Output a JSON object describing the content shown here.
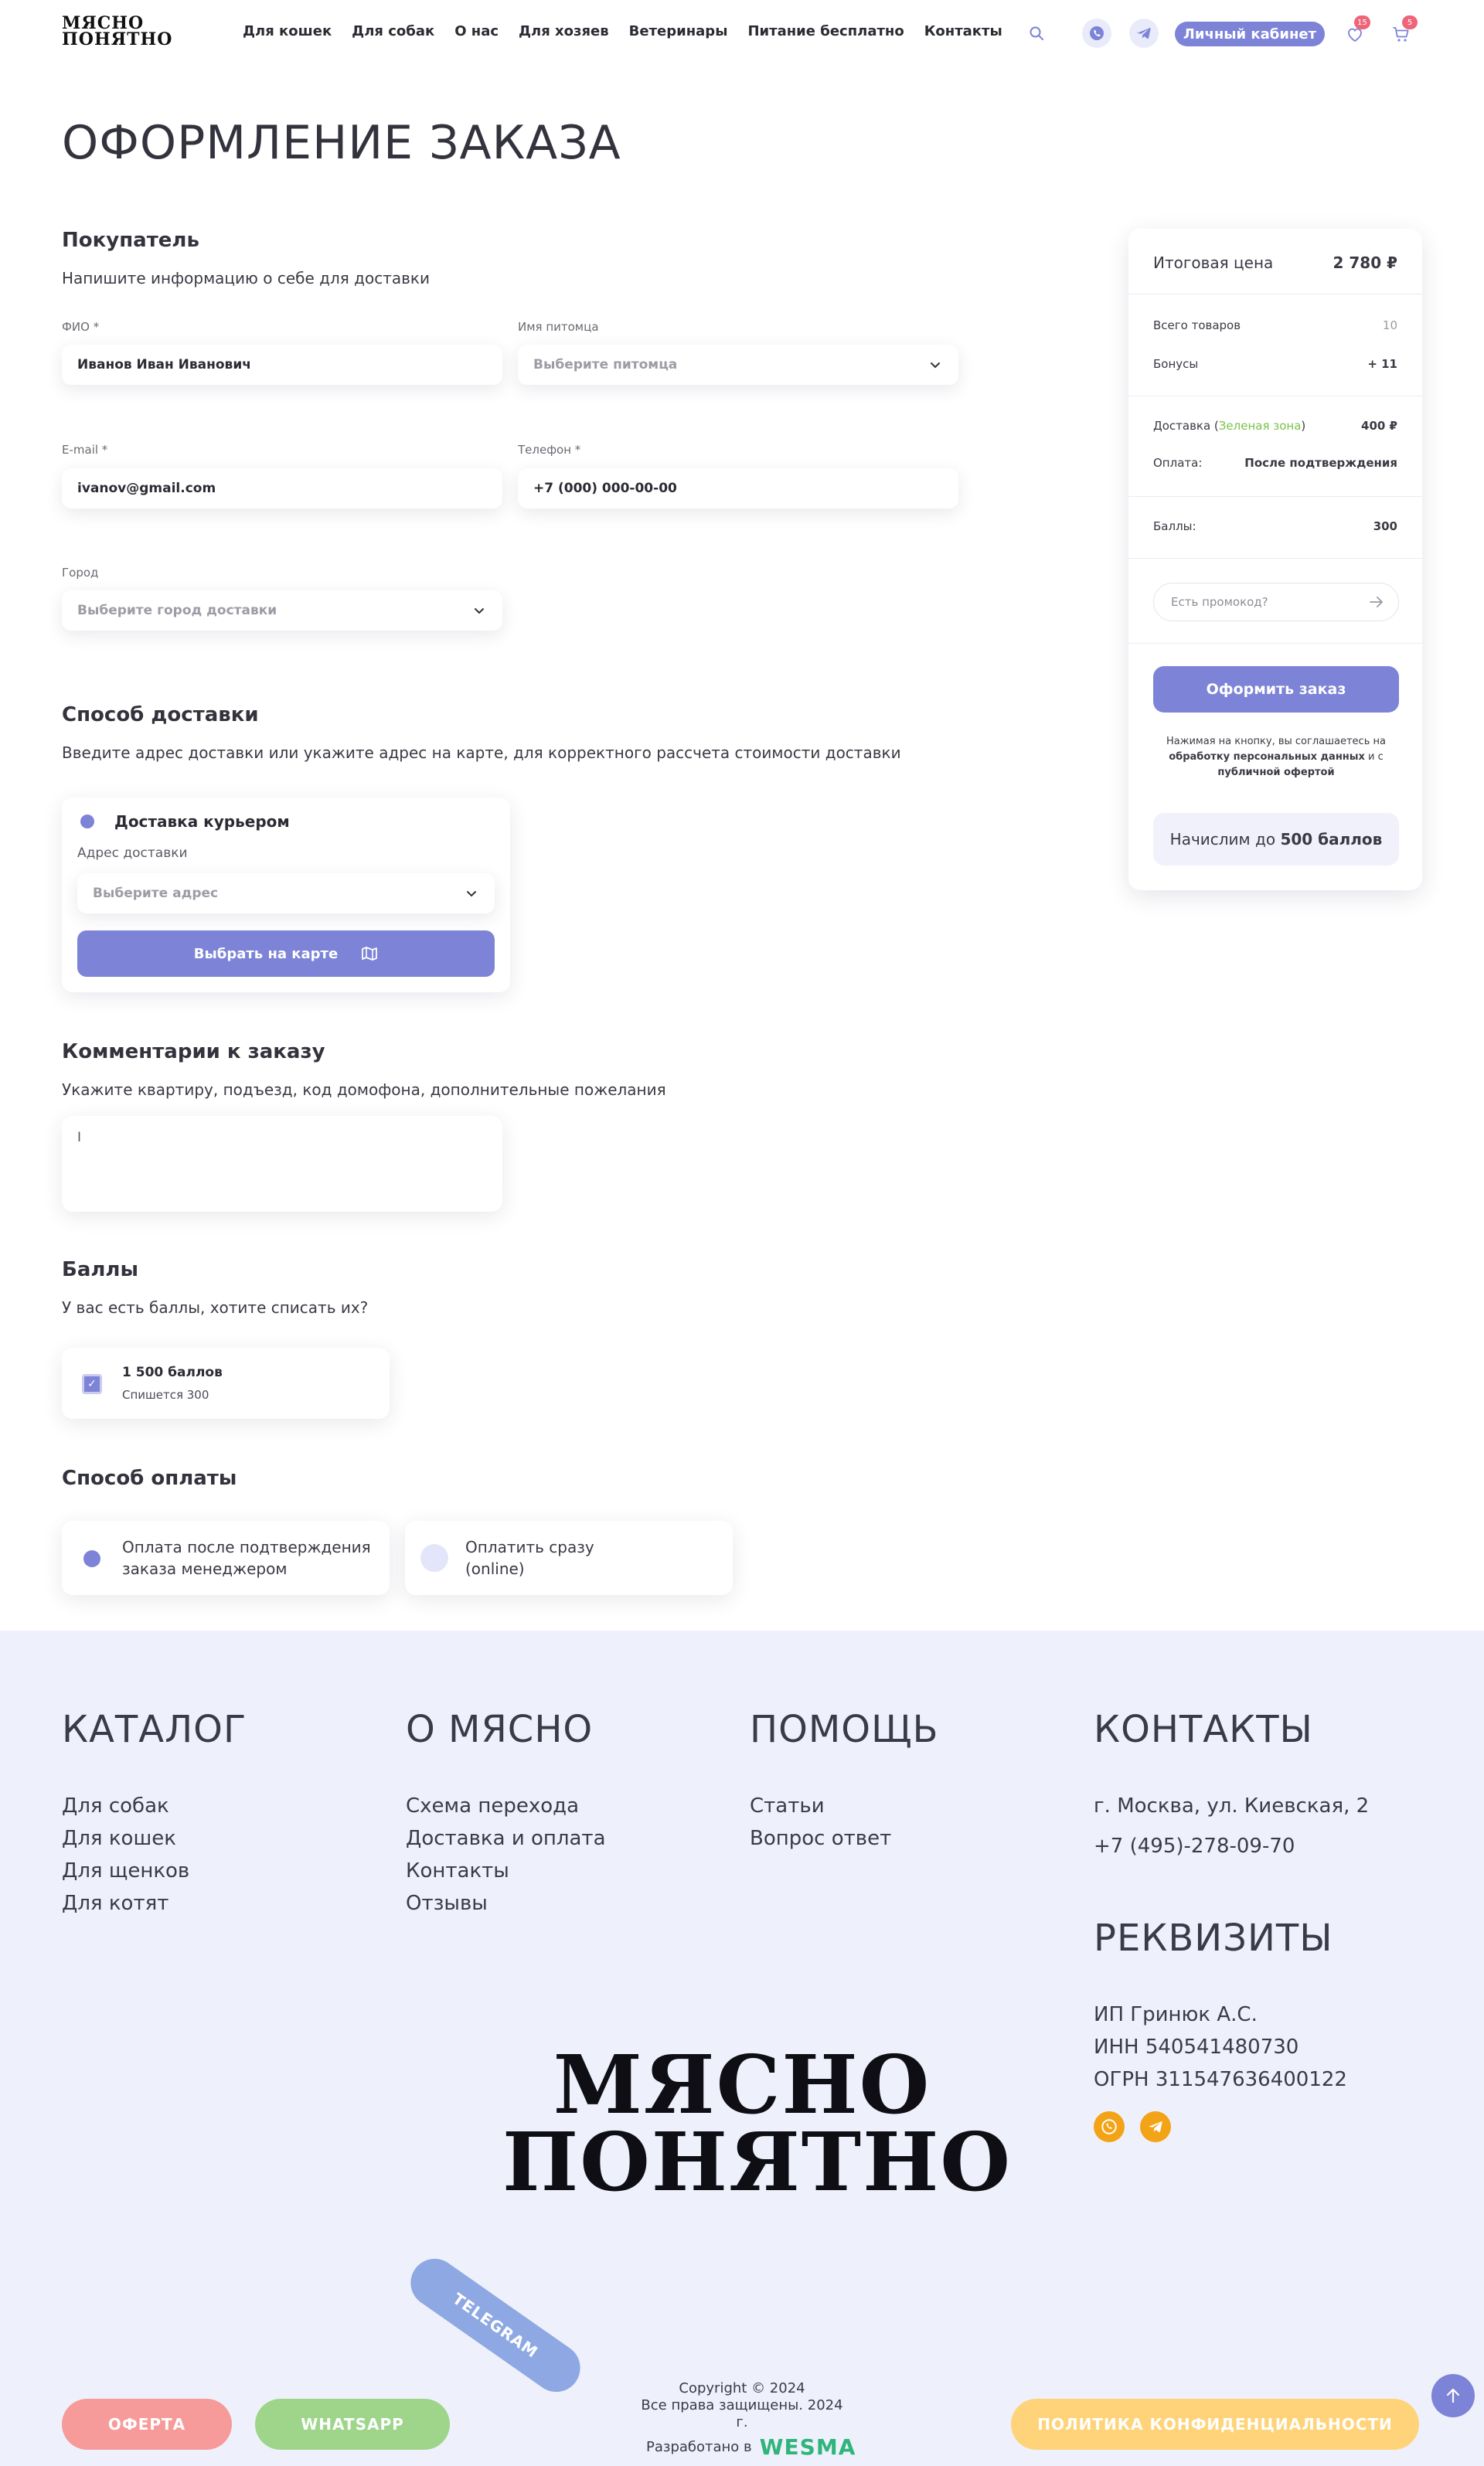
{
  "header": {
    "logo_line1": "МЯСНО",
    "logo_line2": "ПОНЯТНО",
    "nav": [
      "Для кошек",
      "Для собак",
      "О нас",
      "Для хозяев",
      "Ветеринары",
      "Питание бесплатно",
      "Контакты"
    ],
    "cabinet_label": "Личный кабинет",
    "favorites_count": "15",
    "cart_count": "5",
    "accent_color": "#7d83d6"
  },
  "page_title": "ОФОРМЛЕНИЕ ЗАКАЗА",
  "buyer": {
    "title": "Покупатель",
    "subtitle": "Напишите информацию о себе для доставки",
    "fio_label": "ФИО *",
    "fio_value": "Иванов Иван Иванович",
    "pet_label": "Имя питомца",
    "pet_placeholder": "Выберите питомца",
    "email_label": "E-mail *",
    "email_value": "ivanov@gmail.com",
    "phone_label": "Телефон *",
    "phone_value": "+7 (000) 000-00-00",
    "city_label": "Город",
    "city_placeholder": "Выберите город доставки"
  },
  "delivery": {
    "title": "Способ доставки",
    "subtitle": "Введите адрес доставки или укажите адрес на карте, для корректного рассчета стоимости доставки",
    "option_label": "Доставка курьером",
    "address_label": "Адрес доставки",
    "address_placeholder": "Выберите адрес",
    "map_button": "Выбрать на карте"
  },
  "comment": {
    "title": "Комментарии к заказу",
    "subtitle": "Укажите квартиру, подъезд, код домофона, дополнительные пожелания",
    "value": "I"
  },
  "points": {
    "title": "Баллы",
    "subtitle": "У вас есть баллы, хотите списать их?",
    "amount": "1 500 баллов",
    "note": "Спишется 300"
  },
  "payment": {
    "title": "Способ оплаты",
    "option1_line1": "Оплата после подтверждения",
    "option1_line2": "заказа менеджером",
    "option2_line1": "Оплатить сразу",
    "option2_line2": "(online)"
  },
  "summary": {
    "total_label": "Итоговая цена",
    "total_value": "2 780 ₽",
    "items_label": "Всего товаров",
    "items_value": "10",
    "bonus_label": "Бонусы",
    "bonus_value": "+ 11",
    "delivery_label": "Доставка (",
    "delivery_zone": "Зеленая зона",
    "delivery_close": ")",
    "delivery_value": "400 ₽",
    "payment_label": "Оплата:",
    "payment_value": "После подтверждения",
    "points_label": "Баллы:",
    "points_value": "300",
    "promo_placeholder": "Есть промокод?",
    "order_button": "Оформить заказ",
    "agree_text1": "Нажимая на кнопку, вы соглашаетесь на",
    "agree_link1": "обработку персональных данных",
    "agree_text2": " и с",
    "agree_link2": "публичной офертой",
    "bonus_text": "Начислим до ",
    "bonus_amount": "500 баллов",
    "zone_color": "#7cc24a"
  },
  "footer": {
    "catalog_title": "КАТАЛОГ",
    "catalog_links": [
      "Для собак",
      "Для кошек",
      "Для щенков",
      "Для котят"
    ],
    "about_title": "О МЯСНО",
    "about_links": [
      "Схема перехода",
      "Доставка и оплата",
      "Контакты",
      "Отзывы"
    ],
    "help_title": "ПОМОЩЬ",
    "help_links": [
      "Статьи",
      "Вопрос ответ"
    ],
    "contacts_title": "КОНТАКТЫ",
    "address": "г. Москва, ул. Киевская, 2",
    "phone": "+7 (495)-278-09-70",
    "requisites_title": "РЕКВИЗИТЫ",
    "ip": "ИП Гринюк А.С.",
    "inn": "ИНН 540541480730",
    "ogrn": "ОГРН 311547636400122",
    "logo_line1": "МЯСНО",
    "logo_line2": "ПОНЯТНО",
    "pill_offer": "ОФЕРТА",
    "pill_whatsapp": "WHATSAPP",
    "pill_telegram": "TELEGRAM",
    "pill_privacy": "ПОЛИТИКА КОНФИДЕНЦИАЛЬНОСТИ",
    "copyright_line1": "Copyright © 2024",
    "copyright_line2": "Все права защищены. 2024 г.",
    "developed_label": "Разработано в",
    "developer": "WESMA",
    "colors": {
      "offer": "#f79a9a",
      "whatsapp": "#9ed58a",
      "telegram": "#8ea8e4",
      "privacy": "#ffd37a",
      "social": "#f3a316"
    }
  }
}
